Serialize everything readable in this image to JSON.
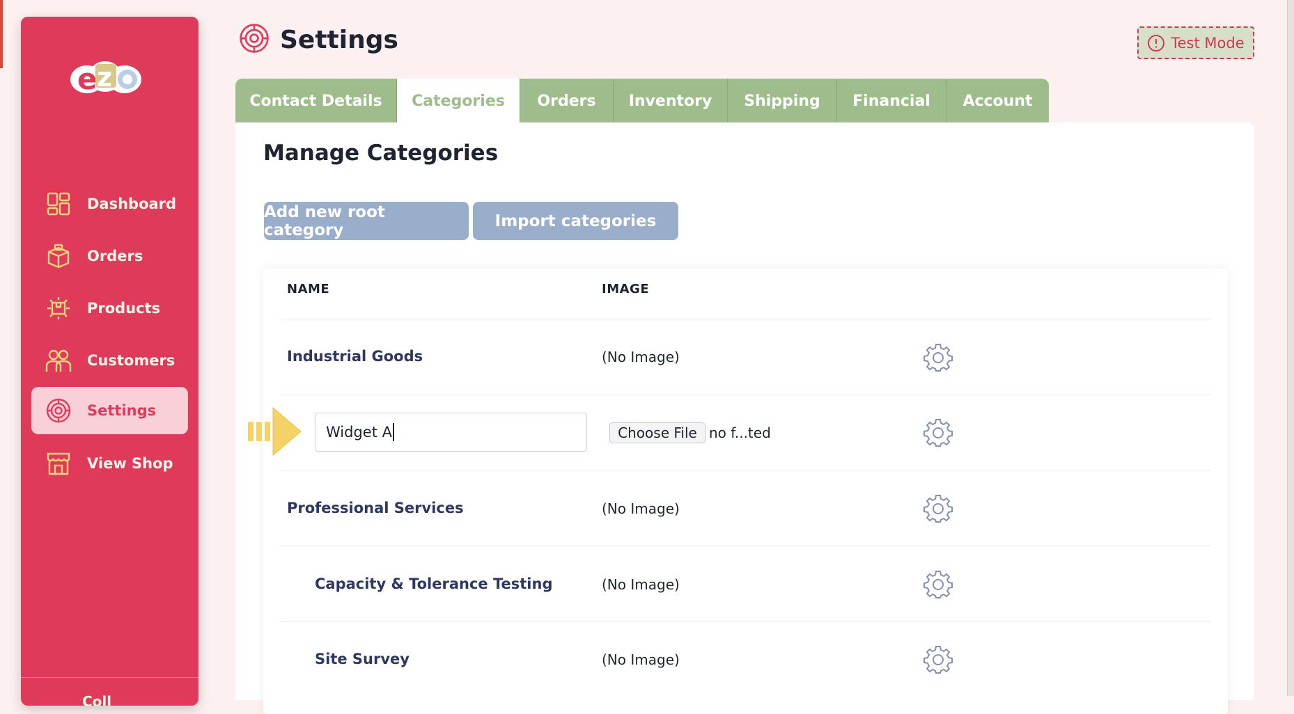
{
  "app": {
    "logo_text": "ezo",
    "page_title": "Settings",
    "test_mode_label": "Test Mode"
  },
  "sidebar": {
    "items": [
      {
        "label": "Dashboard",
        "icon": "dashboard-icon"
      },
      {
        "label": "Orders",
        "icon": "orders-box-icon"
      },
      {
        "label": "Products",
        "icon": "products-icon"
      },
      {
        "label": "Customers",
        "icon": "customers-icon"
      },
      {
        "label": "Settings",
        "icon": "settings-icon",
        "active": true
      },
      {
        "label": "View Shop",
        "icon": "shop-icon"
      }
    ],
    "footer_text": "Coll"
  },
  "tabs": [
    {
      "label": "Contact Details"
    },
    {
      "label": "Categories",
      "active": true
    },
    {
      "label": "Orders"
    },
    {
      "label": "Inventory"
    },
    {
      "label": "Shipping"
    },
    {
      "label": "Financial"
    },
    {
      "label": "Account"
    }
  ],
  "panel": {
    "title": "Manage Categories",
    "add_root_label": "Add new root category",
    "import_label": "Import categories"
  },
  "table": {
    "headers": {
      "name": "NAME",
      "image": "IMAGE"
    },
    "rows": [
      {
        "name": "Industrial Goods",
        "image": "(No Image)",
        "level": 0
      },
      {
        "name": "Widget A",
        "editing": true,
        "file_button": "Choose File",
        "file_status": "no f...ted",
        "level": 1
      },
      {
        "name": "Professional Services",
        "image": "(No Image)",
        "level": 0
      },
      {
        "name": "Capacity & Tolerance Testing",
        "image": "(No Image)",
        "level": 1
      },
      {
        "name": "Site Survey",
        "image": "(No Image)",
        "level": 1
      }
    ]
  },
  "colors": {
    "sidebar": "#e03a5a",
    "tabs": "#9fbd8c",
    "button": "#98aecb",
    "background": "#fdf0f0"
  }
}
